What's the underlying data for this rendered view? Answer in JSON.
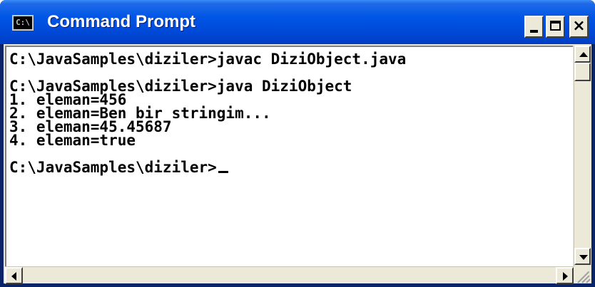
{
  "window": {
    "title": "Command Prompt",
    "icon": "console-icon",
    "icon_text": "C:\\",
    "controls": {
      "minimize": "minimize-icon",
      "maximize": "maximize-icon",
      "close_glyph": "×"
    }
  },
  "console": {
    "lines": [
      "C:\\JavaSamples\\diziler>javac DiziObject.java",
      "",
      "C:\\JavaSamples\\diziler>java DiziObject",
      "1. eleman=456",
      "2. eleman=Ben bir stringim...",
      "3. eleman=45.45687",
      "4. eleman=true",
      "",
      "C:\\JavaSamples\\diziler>"
    ]
  },
  "colors": {
    "title_bar": "#0055e5",
    "console_background": "#ffffff",
    "console_text": "#000000",
    "chrome": "#ece9d8"
  }
}
